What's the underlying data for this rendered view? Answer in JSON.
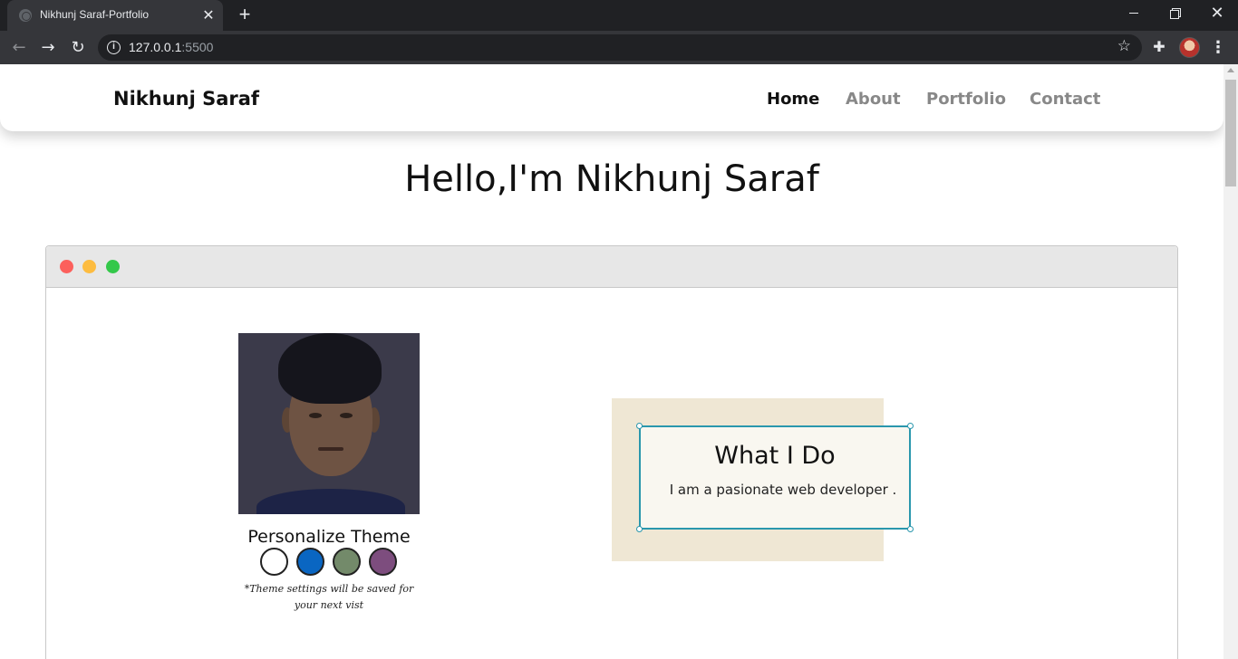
{
  "browser": {
    "tab_title": "Nikhunj Saraf-Portfolio",
    "tab_close": "✕",
    "new_tab": "+",
    "url_host": "127.0.0.1",
    "url_port": ":5500",
    "close_glyph": "✕",
    "star_glyph": "☆",
    "ext_glyph": "✚",
    "menu_glyph": "⋮",
    "back_glyph": "←",
    "forward_glyph": "→",
    "reload_glyph": "↻",
    "info_glyph": "i"
  },
  "nav": {
    "brand": "Nikhunj Saraf",
    "links": [
      "Home",
      "About",
      "Portfolio",
      "Contact"
    ],
    "active": "Home"
  },
  "hero": {
    "title": "Hello,I'm Nikhunj Saraf"
  },
  "theme": {
    "title": "Personalize Theme",
    "swatches": [
      "#ffffff",
      "#0a66c2",
      "#738a6a",
      "#7d4d7e"
    ],
    "note": "*Theme settings will be saved for your next vist"
  },
  "what_i_do": {
    "title": "What I Do",
    "text": "I am a pasionate web developer ."
  },
  "colors": {
    "accent": "#2a97ad",
    "card_bg": "#efe7d4"
  }
}
